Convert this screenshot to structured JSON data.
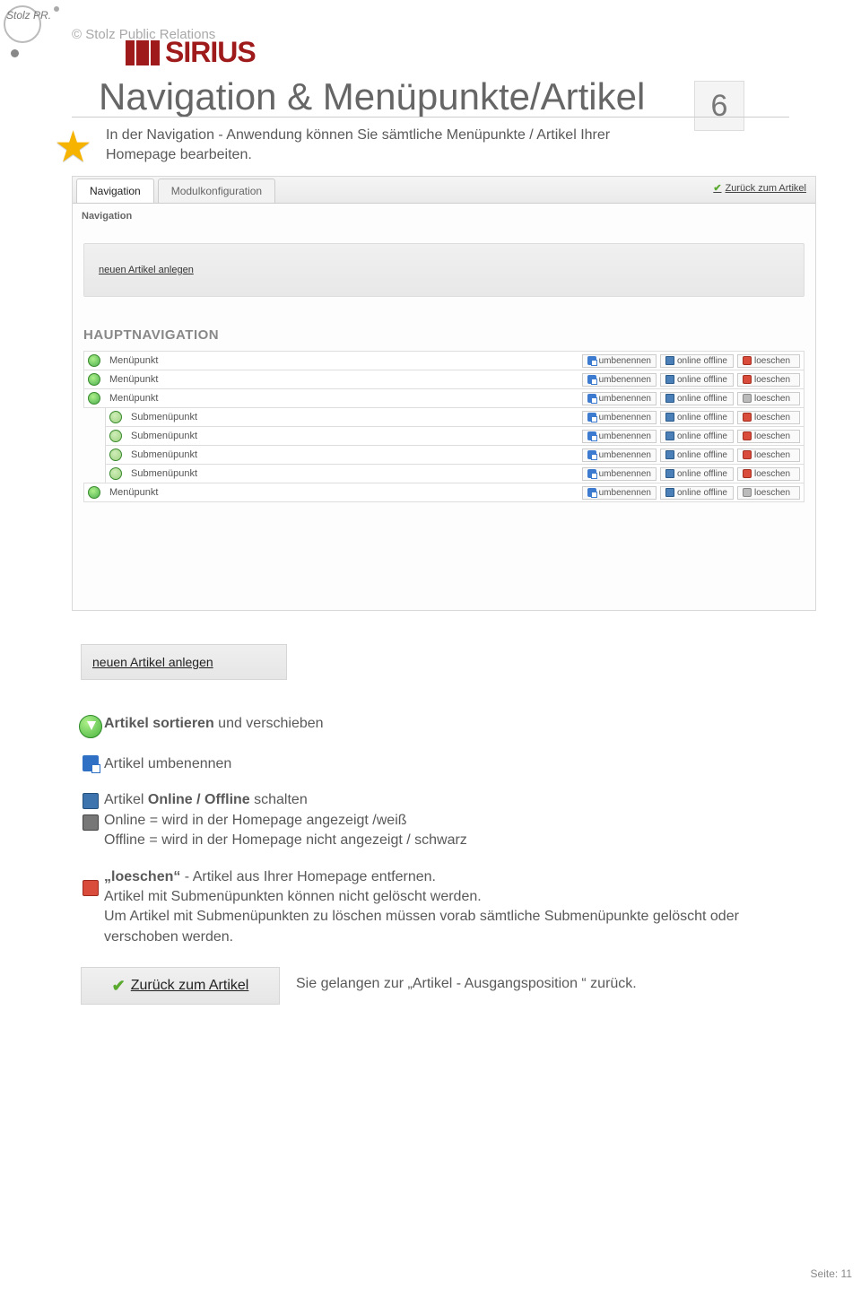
{
  "header": {
    "copyright": "©   Stolz Public Relations",
    "brand_small": "Stolz PR",
    "sirius": "SIRIUS"
  },
  "page": {
    "title": "Navigation & Menüpunkte/Artikel",
    "number": "6",
    "intro": "In der Navigation - Anwendung können Sie sämtliche Menüpunkte / Artikel Ihrer Homepage bearbeiten."
  },
  "ss": {
    "tab_nav": "Navigation",
    "tab_mod": "Modulkonfiguration",
    "back_link": "Zurück zum Artikel",
    "sub_label": "Navigation",
    "new_article": "neuen Artikel anlegen",
    "haupt": "HAUPTNAVIGATION",
    "btn_rename": "umbenennen",
    "btn_onoff": "online offline",
    "btn_delete": "loeschen",
    "rows": [
      {
        "label": "Menüpunkt",
        "indent": false,
        "del_active": true
      },
      {
        "label": "Menüpunkt",
        "indent": false,
        "del_active": true
      },
      {
        "label": "Menüpunkt",
        "indent": false,
        "del_active": false
      },
      {
        "label": "Submenüpunkt",
        "indent": true,
        "del_active": true
      },
      {
        "label": "Submenüpunkt",
        "indent": true,
        "del_active": true
      },
      {
        "label": "Submenüpunkt",
        "indent": true,
        "del_active": true
      },
      {
        "label": "Submenüpunkt",
        "indent": true,
        "del_active": true
      },
      {
        "label": "Menüpunkt",
        "indent": false,
        "del_active": false
      }
    ]
  },
  "frag": {
    "new_article": "neuen Artikel anlegen"
  },
  "legend": {
    "sort_strong": "Artikel sortieren",
    "sort_rest": " und verschieben",
    "rename": "Artikel umbenennen",
    "onoff_line1_pre": "Artikel ",
    "onoff_line1_strong": "Online / Offline",
    "onoff_line1_post": " schalten",
    "onoff_line2": "Online = wird in der Homepage angezeigt /weiß",
    "onoff_line3": "Offline = wird in der Homepage nicht angezeigt / schwarz",
    "del_l1": "„loeschen“ - Artikel aus Ihrer Homepage entfernen.",
    "del_l2": "Artikel mit Submenüpunkten können nicht gelöscht werden.",
    "del_l3": "Um Artikel mit Submenüpunkten zu löschen müssen vorab sämtliche Submenüpunkte gelöscht oder verschoben werden."
  },
  "back": {
    "label": "Zurück zum Artikel",
    "desc": "Sie gelangen zur „Artikel - Ausgangsposition “ zurück."
  },
  "footer": {
    "page": "Seite: 11"
  }
}
